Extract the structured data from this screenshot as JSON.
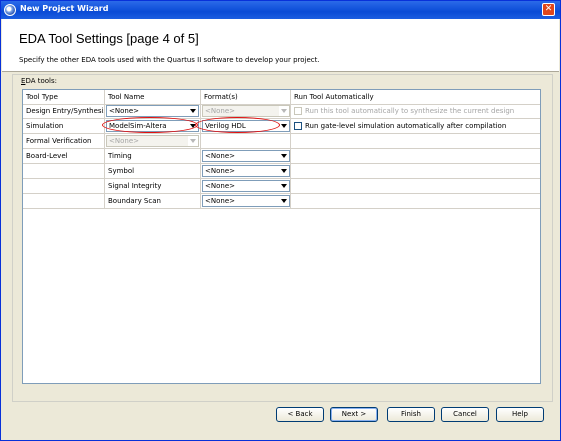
{
  "window": {
    "title": "New Project Wizard"
  },
  "header": {
    "title": "EDA Tool Settings [page 4 of 5]",
    "description": "Specify the other EDA tools used with the Quartus II software to develop your project."
  },
  "eda_tools_label": "EDA tools:",
  "table": {
    "columns": [
      "Tool Type",
      "Tool Name",
      "Format(s)",
      "Run Tool Automatically"
    ],
    "rows": [
      {
        "type": "Design Entry/Synthesis",
        "tool": "<None>",
        "format": "<None>",
        "run_label": "Run this tool automatically to synthesize the current design",
        "run_enabled": false
      },
      {
        "type": "Simulation",
        "tool": "ModelSim-Altera",
        "format": "Verilog HDL",
        "run_label": "Run gate-level simulation automatically after compilation",
        "run_enabled": true
      },
      {
        "type": "Formal Verification",
        "tool": "<None>",
        "format": "",
        "run_label": "",
        "run_enabled": false
      },
      {
        "type": "Board-Level",
        "tool": "Timing",
        "format": "<None>",
        "run_label": "",
        "run_enabled": false
      },
      {
        "type": "",
        "tool": "Symbol",
        "format": "<None>",
        "run_label": "",
        "run_enabled": false
      },
      {
        "type": "",
        "tool": "Signal Integrity",
        "format": "<None>",
        "run_label": "",
        "run_enabled": false
      },
      {
        "type": "",
        "tool": "Boundary Scan",
        "format": "<None>",
        "run_label": "",
        "run_enabled": false
      }
    ]
  },
  "buttons": {
    "back": "< Back",
    "next": "Next >",
    "finish": "Finish",
    "cancel": "Cancel",
    "help": "Help"
  },
  "colors": {
    "titlebar": "#0a4bd6",
    "highlight_ellipse": "#e01010",
    "dialog_bg": "#ece9d8"
  }
}
